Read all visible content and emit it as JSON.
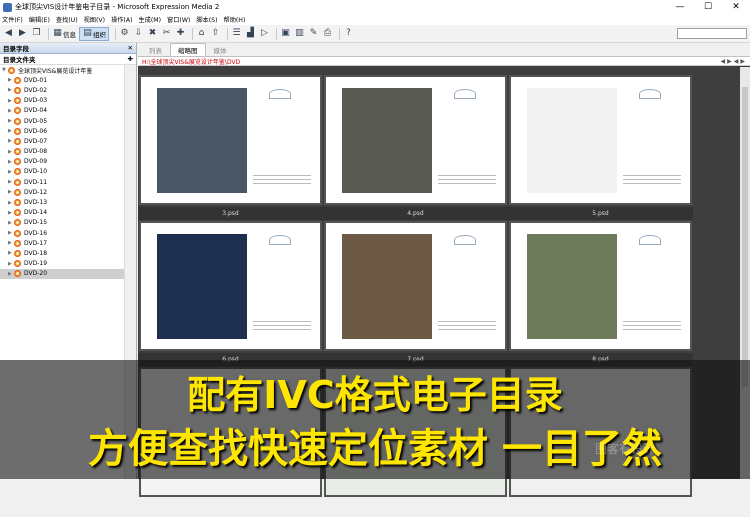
{
  "window": {
    "title": "全球顶尖VIS设计年鉴电子目录 - Microsoft Expression Media 2",
    "min": "—",
    "max": "☐",
    "close": "✕"
  },
  "menu": [
    "文件(F)",
    "编辑(E)",
    "查找(U)",
    "视图(V)",
    "操作(A)",
    "生成(M)",
    "窗口(W)",
    "脚本(S)",
    "帮助(H)"
  ],
  "toolbar": {
    "info_label": "信息",
    "organize_label": "组织"
  },
  "catalog": {
    "panel_title": "目录字段",
    "folders_title": "目录文件夹",
    "root": "全球顶尖VIS&展览设计年鉴",
    "selected": "DVD-20",
    "items": [
      "DVD-01",
      "DVD-02",
      "DVD-03",
      "DVD-04",
      "DVD-05",
      "DVD-06",
      "DVD-07",
      "DVD-08",
      "DVD-09",
      "DVD-10",
      "DVD-11",
      "DVD-12",
      "DVD-13",
      "DVD-14",
      "DVD-15",
      "DVD-16",
      "DVD-17",
      "DVD-18",
      "DVD-19",
      "DVD-20"
    ]
  },
  "view": {
    "tab_list": "列表",
    "tab_thumbs": "缩略图",
    "tab_media": "媒体",
    "path": "H:\\全球顶尖VIS&展览设计年鉴\\DVD"
  },
  "thumbs": [
    {
      "file": "3.psd",
      "color": "#4a5566"
    },
    {
      "file": "4.psd",
      "color": "#5a5a55"
    },
    {
      "file": "5.psd",
      "color": "#f2f2f2"
    },
    {
      "file": "6.psd",
      "color": "#1d2e4e"
    },
    {
      "file": "7.psd",
      "color": "#6d5a44"
    },
    {
      "file": "8.psd",
      "color": "#6d7b5a"
    }
  ],
  "banner": {
    "line1": "配有IVC格式电子目录",
    "line2": "方便查找快速定位素材 一目了然"
  },
  "watermark": "图客有设计"
}
